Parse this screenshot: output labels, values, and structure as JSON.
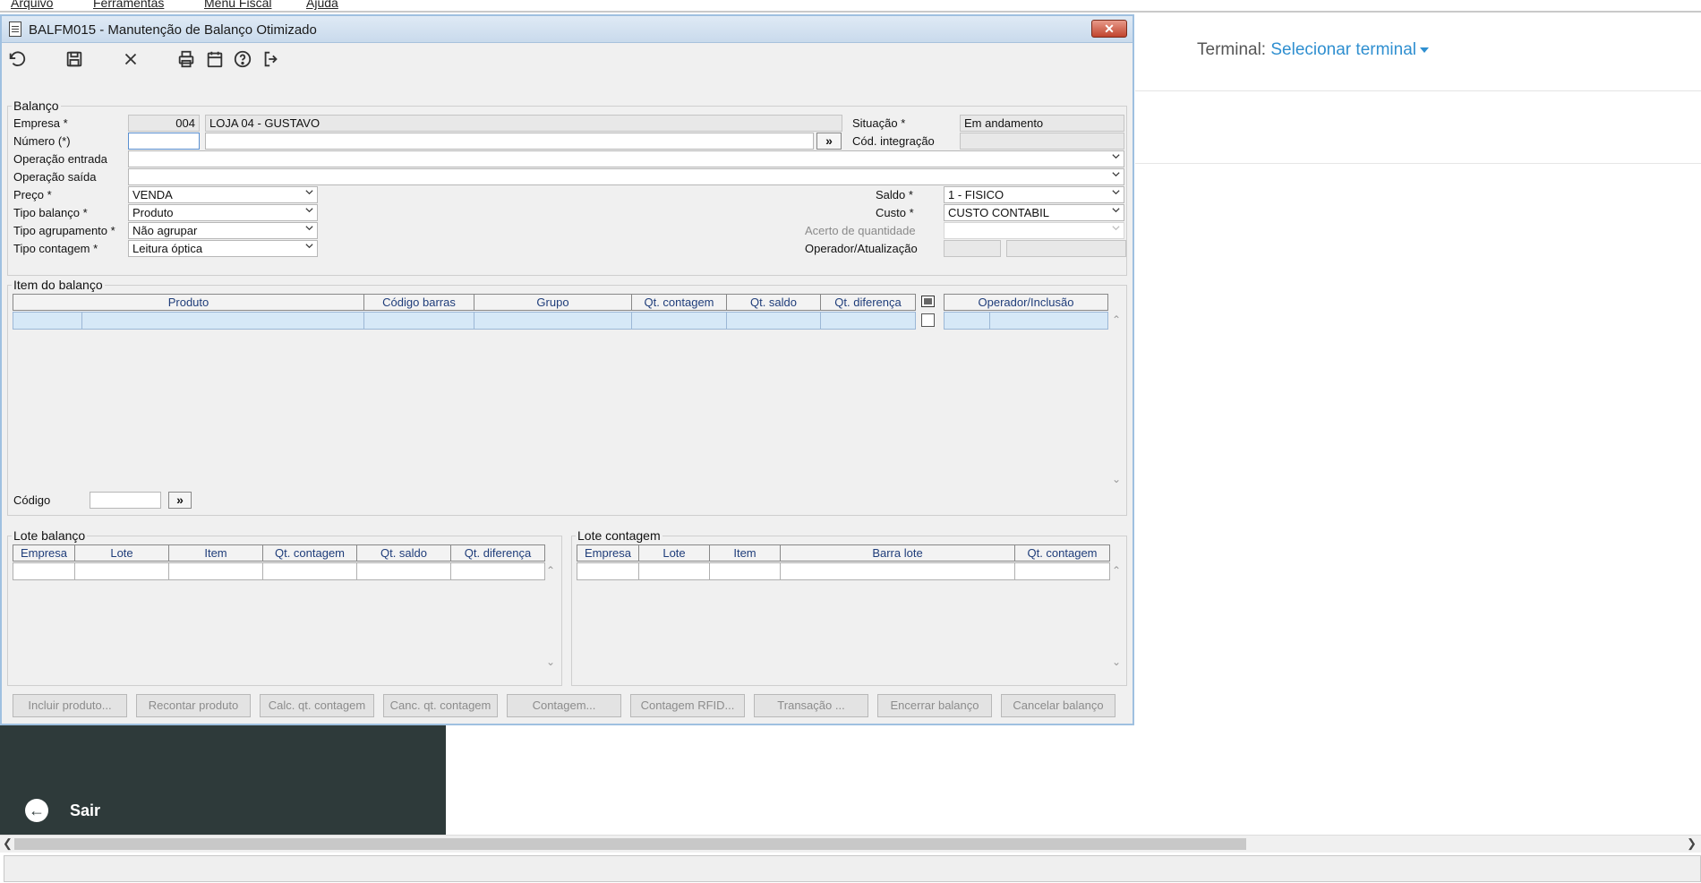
{
  "menu": {
    "items": [
      "Arquivo",
      "Ferramentas",
      "Menu Fiscal",
      "Ajuda"
    ]
  },
  "header": {
    "terminal_label": "Terminal:",
    "terminal_select": "Selecionar terminal"
  },
  "sidebar": {
    "exit_label": "Sair"
  },
  "window": {
    "title": "BALFM015 - Manutenção de Balanço Otimizado",
    "close_glyph": "✕"
  },
  "toolbar": {
    "icons": [
      "undo-icon",
      "save-icon",
      "close-icon",
      "print-icon",
      "calendar-icon",
      "help-icon",
      "exit-icon"
    ]
  },
  "balanco": {
    "group_label": "Balanço",
    "empresa_label": "Empresa *",
    "empresa_code": "004",
    "empresa_name": "LOJA 04 - GUSTAVO",
    "situacao_label": "Situação *",
    "situacao_value": "Em andamento",
    "numero_label": "Número (*)",
    "numero_value": "",
    "numero_desc": "",
    "lookup_glyph": "»",
    "cod_integracao_label": "Cód. integração",
    "cod_integracao_value": "",
    "operacao_entrada_label": "Operação entrada",
    "operacao_entrada_value": "",
    "operacao_saida_label": "Operação saída",
    "operacao_saida_value": "",
    "preco_label": "Preço *",
    "preco_value": "VENDA",
    "tipo_balanco_label": "Tipo balanço *",
    "tipo_balanco_value": "Produto",
    "tipo_agrupamento_label": "Tipo agrupamento *",
    "tipo_agrupamento_value": "Não agrupar",
    "tipo_contagem_label": "Tipo contagem *",
    "tipo_contagem_value": "Leitura óptica",
    "saldo_label": "Saldo *",
    "saldo_value": "1 - FISICO",
    "custo_label": "Custo *",
    "custo_value": "CUSTO CONTABIL",
    "acerto_label": "Acerto de quantidade",
    "acerto_value": "",
    "operador_label": "Operador/Atualização",
    "operador_code": "",
    "operador_name": ""
  },
  "item_balanco": {
    "group_label": "Item do balanço",
    "columns": [
      "Produto",
      "Código barras",
      "Grupo",
      "Qt. contagem",
      "Qt. saldo",
      "Qt. diferença",
      "Operador/Inclusão"
    ],
    "codigo_label": "Código",
    "codigo_value": ""
  },
  "lote_balanco": {
    "group_label": "Lote balanço",
    "columns": [
      "Empresa",
      "Lote",
      "Item",
      "Qt. contagem",
      "Qt. saldo",
      "Qt. diferença"
    ]
  },
  "lote_contagem": {
    "group_label": "Lote contagem",
    "columns": [
      "Empresa",
      "Lote",
      "Item",
      "Barra lote",
      "Qt. contagem"
    ]
  },
  "actions": [
    "Incluir produto...",
    "Recontar produto",
    "Calc. qt. contagem",
    "Canc. qt. contagem",
    "Contagem...",
    "Contagem RFID...",
    "Transação ...",
    "Encerrar balanço",
    "Cancelar balanço"
  ],
  "colors": {
    "grid_selected": "#d6e8f7",
    "window_bg": "#f0f0f0",
    "sidebar_bg": "#2e3a3a",
    "terminal_link": "#2f8fd0"
  }
}
